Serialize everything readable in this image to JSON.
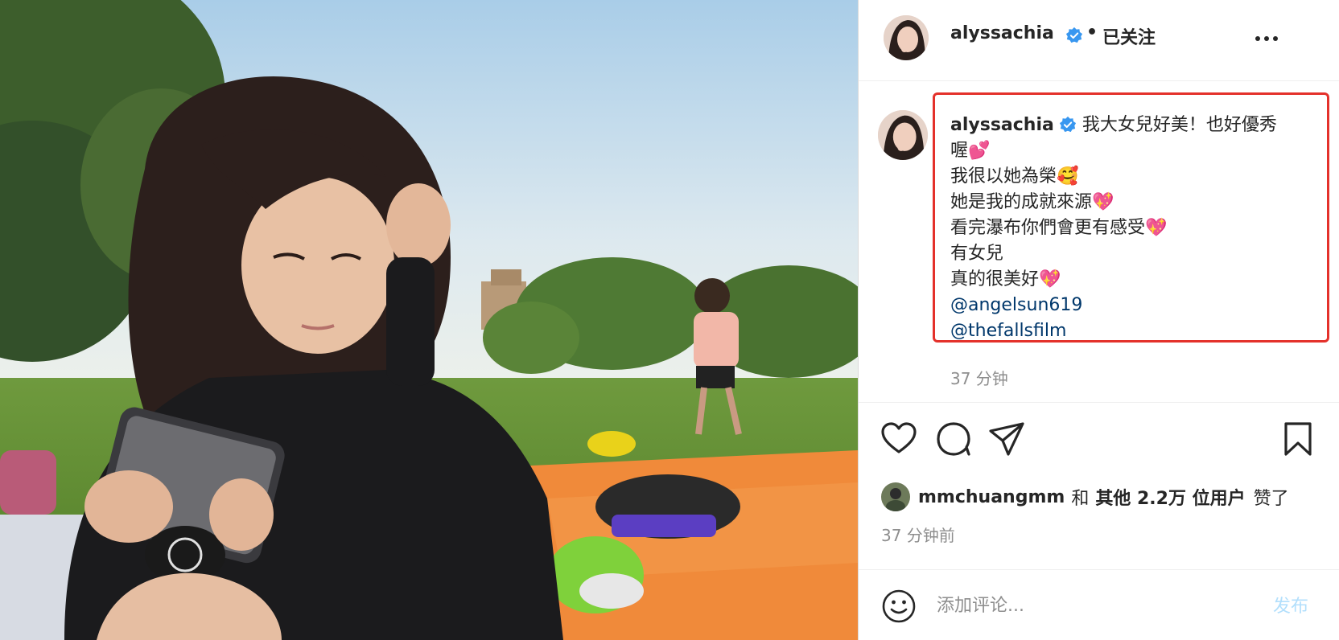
{
  "header": {
    "username": "alyssachia",
    "separator": "•",
    "follow_status": "已关注",
    "more_icon": "more-horizontal-icon"
  },
  "caption": {
    "username": "alyssachia",
    "line1": "我大女兒好美！也好優秀",
    "line2": "喔💕",
    "line3": "我很以她為榮🥰",
    "line4": "她是我的成就來源💖",
    "line5": "看完瀑布你們會更有感受💖",
    "line6": "有女兒",
    "line7": "真的很美好💖",
    "mention1": "@angelsun619",
    "mention2": "@thefallsfilm",
    "time": "37 分钟"
  },
  "actions": {
    "like_icon": "heart-icon",
    "comment_icon": "comment-icon",
    "share_icon": "send-icon",
    "save_icon": "bookmark-icon"
  },
  "likes": {
    "user": "mmchuangmm",
    "and": "和",
    "others": "其他 2.2万 位用户",
    "suffix": "赞了",
    "time": "37 分钟前"
  },
  "comment": {
    "placeholder": "添加评论...",
    "post_label": "发布",
    "emoji_icon": "smile-icon"
  },
  "colors": {
    "highlight_border": "#e4312b",
    "link": "#00376b",
    "verified": "#3897f0",
    "muted": "#8e8e8e",
    "post_disabled": "#b2dffc"
  }
}
